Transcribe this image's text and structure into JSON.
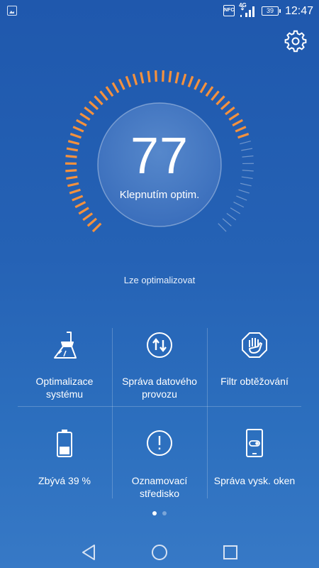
{
  "status_bar": {
    "nfc": "NFC",
    "network_type": "4G",
    "battery_level": "39",
    "time": "12:47"
  },
  "gauge": {
    "score": "77",
    "action_label": "Klepnutím optim.",
    "status_text": "Lze optimalizovat",
    "progress_fraction": 0.77,
    "accent_color": "#f5913d"
  },
  "tiles": [
    {
      "label": "Optimalizace systému",
      "icon": "broom-icon"
    },
    {
      "label": "Správa datového provozu",
      "icon": "data-transfer-icon"
    },
    {
      "label": "Filtr obtěžování",
      "icon": "hand-block-icon"
    },
    {
      "label": "Zbývá 39 %",
      "icon": "battery-icon"
    },
    {
      "label": "Oznamovací středisko",
      "icon": "notification-icon"
    },
    {
      "label": "Správa vysk. oken",
      "icon": "floating-window-icon"
    }
  ],
  "pager": {
    "page_count": 2,
    "active_page": 1
  },
  "nav": {
    "back": "back-icon",
    "home": "home-icon",
    "recents": "recents-icon"
  }
}
